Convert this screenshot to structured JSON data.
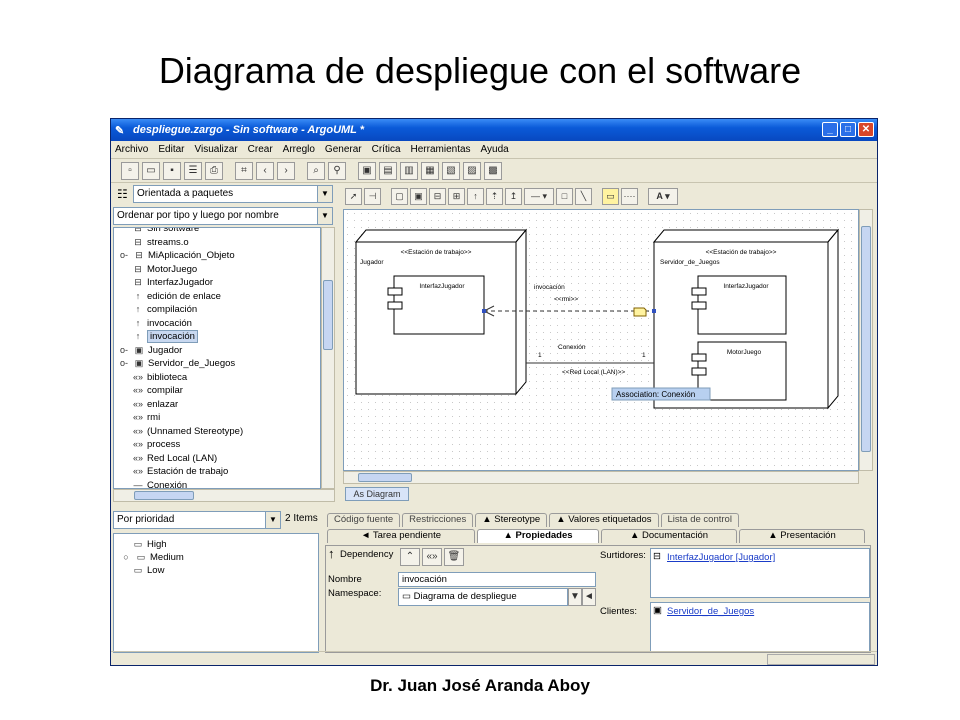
{
  "slide": {
    "title": "Diagrama de despliegue con el software",
    "footer": "Dr. Juan José Aranda Aboy"
  },
  "window": {
    "title": "despliegue.zargo - Sin software - ArgoUML *",
    "buttons": [
      "minimize",
      "maximize",
      "close"
    ]
  },
  "menu": [
    "Archivo",
    "Editar",
    "Visualizar",
    "Crear",
    "Arreglo",
    "Generar",
    "Crítica",
    "Herramientas",
    "Ayuda"
  ],
  "explorer": {
    "perspective": "Orientada a paquetes",
    "order": "Ordenar por tipo y luego por nombre",
    "items": [
      {
        "icon": "component-icon",
        "label": "Sin software"
      },
      {
        "icon": "component-icon",
        "label": "streams.o"
      },
      {
        "icon": "component-icon",
        "label": "MiAplicación_Objeto"
      },
      {
        "icon": "component-icon",
        "label": "MotorJuego"
      },
      {
        "icon": "component-icon",
        "label": "InterfazJugador"
      },
      {
        "icon": "dependency-icon",
        "label": "edición de enlace"
      },
      {
        "icon": "dependency-icon",
        "label": "compilación"
      },
      {
        "icon": "dependency-icon",
        "label": "invocación"
      },
      {
        "icon": "dependency-icon",
        "label": "invocación",
        "selected": true
      },
      {
        "icon": "node-icon",
        "label": "Jugador"
      },
      {
        "icon": "node-icon",
        "label": "Servidor_de_Juegos"
      },
      {
        "icon": "stereotype-icon",
        "label": "biblioteca"
      },
      {
        "icon": "stereotype-icon",
        "label": "compilar"
      },
      {
        "icon": "stereotype-icon",
        "label": "enlazar"
      },
      {
        "icon": "stereotype-icon",
        "label": "rmi"
      },
      {
        "icon": "stereotype-icon",
        "label": "(Unnamed Stereotype)"
      },
      {
        "icon": "stereotype-icon",
        "label": "process"
      },
      {
        "icon": "stereotype-icon",
        "label": "Red Local (LAN)"
      },
      {
        "icon": "stereotype-icon",
        "label": "Estación de trabajo"
      },
      {
        "icon": "association-icon",
        "label": "Conexión"
      }
    ]
  },
  "diagram": {
    "tab": "As Diagram",
    "node_left": {
      "stereotype": "<<Estación de trabajo>>",
      "name": "Jugador",
      "component": "InterfazJugador"
    },
    "node_right": {
      "stereotype": "<<Estación de trabajo>>",
      "name": "Servidor_de_Juegos",
      "component1": "InterfazJugador",
      "component2": "MotorJuego"
    },
    "dependency": {
      "name": "invocación",
      "stereotype": "<<rmi>>"
    },
    "association": {
      "name": "Conexión",
      "stereotype": "<<Red Local (LAN)>>",
      "mult_left": "1",
      "mult_right": "1"
    },
    "tooltip": "Association: Conexión"
  },
  "todo": {
    "order": "Por prioridad",
    "count": "2 Items",
    "items": [
      "High",
      "Medium",
      "Low"
    ]
  },
  "details": {
    "tabs_top": [
      "Código fuente",
      "Restricciones",
      "▲ Stereotype",
      "▲ Valores etiquetados",
      "Lista de control"
    ],
    "tabs_bottom": [
      "◄ Tarea pendiente",
      "▲ Propiedades",
      "▲ Documentación",
      "▲ Presentación"
    ],
    "type": "Dependency",
    "name_label": "Nombre",
    "name_value": "invocación",
    "namespace_label": "Namespace:",
    "namespace_value": "Diagrama de despliegue",
    "suppliers_label": "Surtidores:",
    "supplier": "InterfazJugador [Jugador]",
    "clients_label": "Clientes:",
    "client": "Servidor_de_Juegos"
  }
}
